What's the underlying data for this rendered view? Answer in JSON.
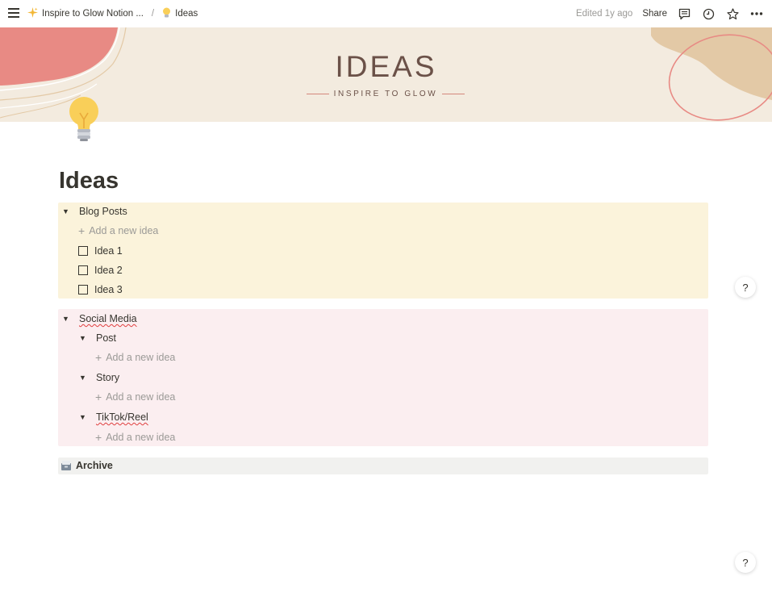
{
  "topbar": {
    "breadcrumbs": [
      {
        "label": "Inspire to Glow Notion ...",
        "icon": "sparkles-icon"
      },
      {
        "label": "Ideas",
        "icon": "lightbulb-icon"
      }
    ],
    "separator": "/",
    "edited": "Edited 1y ago",
    "share_label": "Share"
  },
  "cover": {
    "title": "IDEAS",
    "subtitle": "INSPIRE TO GLOW",
    "colors": {
      "background": "#f3ebdf",
      "accent": "#e88a84",
      "tan": "#e3c9a6"
    }
  },
  "page": {
    "title": "Ideas"
  },
  "blog": {
    "label": "Blog Posts",
    "add_label": "Add a new idea",
    "items": [
      "Idea 1",
      "Idea 2",
      "Idea 3"
    ],
    "color": "#fbf3db"
  },
  "social": {
    "label": "Social Media",
    "color": "#fbeef0",
    "groups": [
      {
        "label": "Post",
        "add_label": "Add a new idea"
      },
      {
        "label": "Story",
        "add_label": "Add a new idea"
      },
      {
        "label": "TikTok/Reel",
        "add_label": "Add a new idea"
      }
    ]
  },
  "archive": {
    "label": "Archive",
    "icon": "card-file-box-icon"
  },
  "help_label": "?"
}
